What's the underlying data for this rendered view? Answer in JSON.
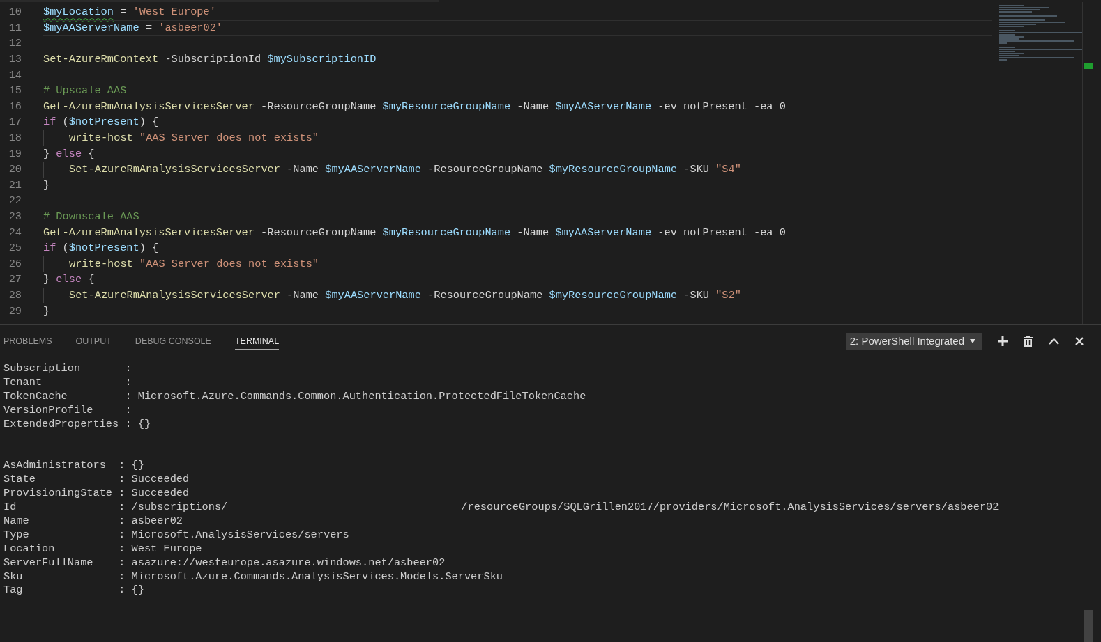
{
  "editor": {
    "lines": [
      {
        "number": "10",
        "current": false,
        "indented": false,
        "tokens": [
          {
            "kind": "variable_warned",
            "text": "$myLocation"
          },
          {
            "kind": "plain",
            "text": " = "
          },
          {
            "kind": "string",
            "text": "'West Europe'"
          }
        ]
      },
      {
        "number": "11",
        "current": true,
        "indented": false,
        "tokens": [
          {
            "kind": "variable",
            "text": "$myAAServerName"
          },
          {
            "kind": "plain",
            "text": " = "
          },
          {
            "kind": "string",
            "text": "'asbeer02'"
          }
        ]
      },
      {
        "number": "12",
        "current": false,
        "indented": false
      },
      {
        "number": "13",
        "current": false,
        "indented": false,
        "tokens": [
          {
            "kind": "command",
            "text": "Set-AzureRmContext"
          },
          {
            "kind": "plain",
            "text": " -SubscriptionId "
          },
          {
            "kind": "variable",
            "text": "$mySubscriptionID"
          }
        ]
      },
      {
        "number": "14",
        "current": false,
        "indented": false
      },
      {
        "number": "15",
        "current": false,
        "indented": false,
        "tokens": [
          {
            "kind": "comment",
            "text": "# Upscale AAS"
          }
        ]
      },
      {
        "number": "16",
        "current": false,
        "indented": false,
        "tokens": [
          {
            "kind": "command",
            "text": "Get-AzureRmAnalysisServicesServer"
          },
          {
            "kind": "plain",
            "text": " -ResourceGroupName "
          },
          {
            "kind": "variable",
            "text": "$myResourceGroupName"
          },
          {
            "kind": "plain",
            "text": " -Name "
          },
          {
            "kind": "variable",
            "text": "$myAAServerName"
          },
          {
            "kind": "plain",
            "text": " -ev notPresent -ea 0"
          }
        ]
      },
      {
        "number": "17",
        "current": false,
        "indented": false,
        "tokens": [
          {
            "kind": "keyword",
            "text": "if"
          },
          {
            "kind": "plain",
            "text": " ("
          },
          {
            "kind": "variable",
            "text": "$notPresent"
          },
          {
            "kind": "plain",
            "text": ") {"
          }
        ]
      },
      {
        "number": "18",
        "current": false,
        "indented": true,
        "tokens": [
          {
            "kind": "command",
            "text": "write-host"
          },
          {
            "kind": "string",
            "text": " \"AAS Server does not exists\""
          }
        ]
      },
      {
        "number": "19",
        "current": false,
        "indented": false,
        "tokens": [
          {
            "kind": "plain",
            "text": "} "
          },
          {
            "kind": "keyword",
            "text": "else"
          },
          {
            "kind": "plain",
            "text": " {"
          }
        ]
      },
      {
        "number": "20",
        "current": false,
        "indented": true,
        "tokens": [
          {
            "kind": "command",
            "text": "Set-AzureRmAnalysisServicesServer"
          },
          {
            "kind": "plain",
            "text": " -Name "
          },
          {
            "kind": "variable",
            "text": "$myAAServerName"
          },
          {
            "kind": "plain",
            "text": " -ResourceGroupName "
          },
          {
            "kind": "variable",
            "text": "$myResourceGroupName"
          },
          {
            "kind": "plain",
            "text": " -SKU "
          },
          {
            "kind": "string",
            "text": "\"S4\""
          }
        ]
      },
      {
        "number": "21",
        "current": false,
        "indented": false,
        "tokens": [
          {
            "kind": "plain",
            "text": "}"
          }
        ]
      },
      {
        "number": "22",
        "current": false,
        "indented": false
      },
      {
        "number": "23",
        "current": false,
        "indented": false,
        "tokens": [
          {
            "kind": "comment",
            "text": "# Downscale AAS"
          }
        ]
      },
      {
        "number": "24",
        "current": false,
        "indented": false,
        "tokens": [
          {
            "kind": "command",
            "text": "Get-AzureRmAnalysisServicesServer"
          },
          {
            "kind": "plain",
            "text": " -ResourceGroupName "
          },
          {
            "kind": "variable",
            "text": "$myResourceGroupName"
          },
          {
            "kind": "plain",
            "text": " -Name "
          },
          {
            "kind": "variable",
            "text": "$myAAServerName"
          },
          {
            "kind": "plain",
            "text": " -ev notPresent -ea 0"
          }
        ]
      },
      {
        "number": "25",
        "current": false,
        "indented": false,
        "tokens": [
          {
            "kind": "keyword",
            "text": "if"
          },
          {
            "kind": "plain",
            "text": " ("
          },
          {
            "kind": "variable",
            "text": "$notPresent"
          },
          {
            "kind": "plain",
            "text": ") {"
          }
        ]
      },
      {
        "number": "26",
        "current": false,
        "indented": true,
        "tokens": [
          {
            "kind": "command",
            "text": "write-host"
          },
          {
            "kind": "string",
            "text": " \"AAS Server does not exists\""
          }
        ]
      },
      {
        "number": "27",
        "current": false,
        "indented": false,
        "tokens": [
          {
            "kind": "plain",
            "text": "} "
          },
          {
            "kind": "keyword",
            "text": "else"
          },
          {
            "kind": "plain",
            "text": " {"
          }
        ]
      },
      {
        "number": "28",
        "current": false,
        "indented": true,
        "tokens": [
          {
            "kind": "command",
            "text": "Set-AzureRmAnalysisServicesServer"
          },
          {
            "kind": "plain",
            "text": " -Name "
          },
          {
            "kind": "variable",
            "text": "$myAAServerName"
          },
          {
            "kind": "plain",
            "text": " -ResourceGroupName "
          },
          {
            "kind": "variable",
            "text": "$myResourceGroupName"
          },
          {
            "kind": "plain",
            "text": " -SKU "
          },
          {
            "kind": "string",
            "text": "\"S2\""
          }
        ]
      },
      {
        "number": "29",
        "current": false,
        "indented": false,
        "tokens": [
          {
            "kind": "plain",
            "text": "}"
          }
        ]
      }
    ]
  },
  "panel": {
    "tabs": [
      {
        "label": "PROBLEMS",
        "selected": false
      },
      {
        "label": "OUTPUT",
        "selected": false
      },
      {
        "label": "DEBUG CONSOLE",
        "selected": false
      },
      {
        "label": "TERMINAL",
        "selected": true
      }
    ],
    "terminal_picker": {
      "value": "2: PowerShell Integrated"
    },
    "terminal": {
      "blocks": [
        [
          {
            "key": "Subscription",
            "value": ":"
          },
          {
            "key": "Tenant",
            "value": ":"
          },
          {
            "key": "TokenCache",
            "value": ": Microsoft.Azure.Commands.Common.Authentication.ProtectedFileTokenCache"
          },
          {
            "key": "VersionProfile",
            "value": ":"
          },
          {
            "key": "ExtendedProperties",
            "value": ": {}"
          }
        ],
        [
          {
            "key": "AsAdministrators",
            "value": ": {}"
          },
          {
            "key": "State",
            "value": ": Succeeded"
          },
          {
            "key": "ProvisioningState",
            "value": ": Succeeded"
          },
          {
            "key": "Id",
            "value": ": /subscriptions/",
            "value_2": "/resourceGroups/SQLGrillen2017/providers/Microsoft.AnalysisServices/servers/asbeer02"
          },
          {
            "key": "Name",
            "value": ": asbeer02"
          },
          {
            "key": "Type",
            "value": ": Microsoft.AnalysisServices/servers"
          },
          {
            "key": "Location",
            "value": ": West Europe"
          },
          {
            "key": "ServerFullName",
            "value": ": asazure://westeurope.asazure.windows.net/asbeer02"
          },
          {
            "key": "Sku",
            "value": ": Microsoft.Azure.Commands.AnalysisServices.Models.ServerSku"
          },
          {
            "key": "Tag",
            "value": ": {}"
          }
        ]
      ]
    }
  }
}
